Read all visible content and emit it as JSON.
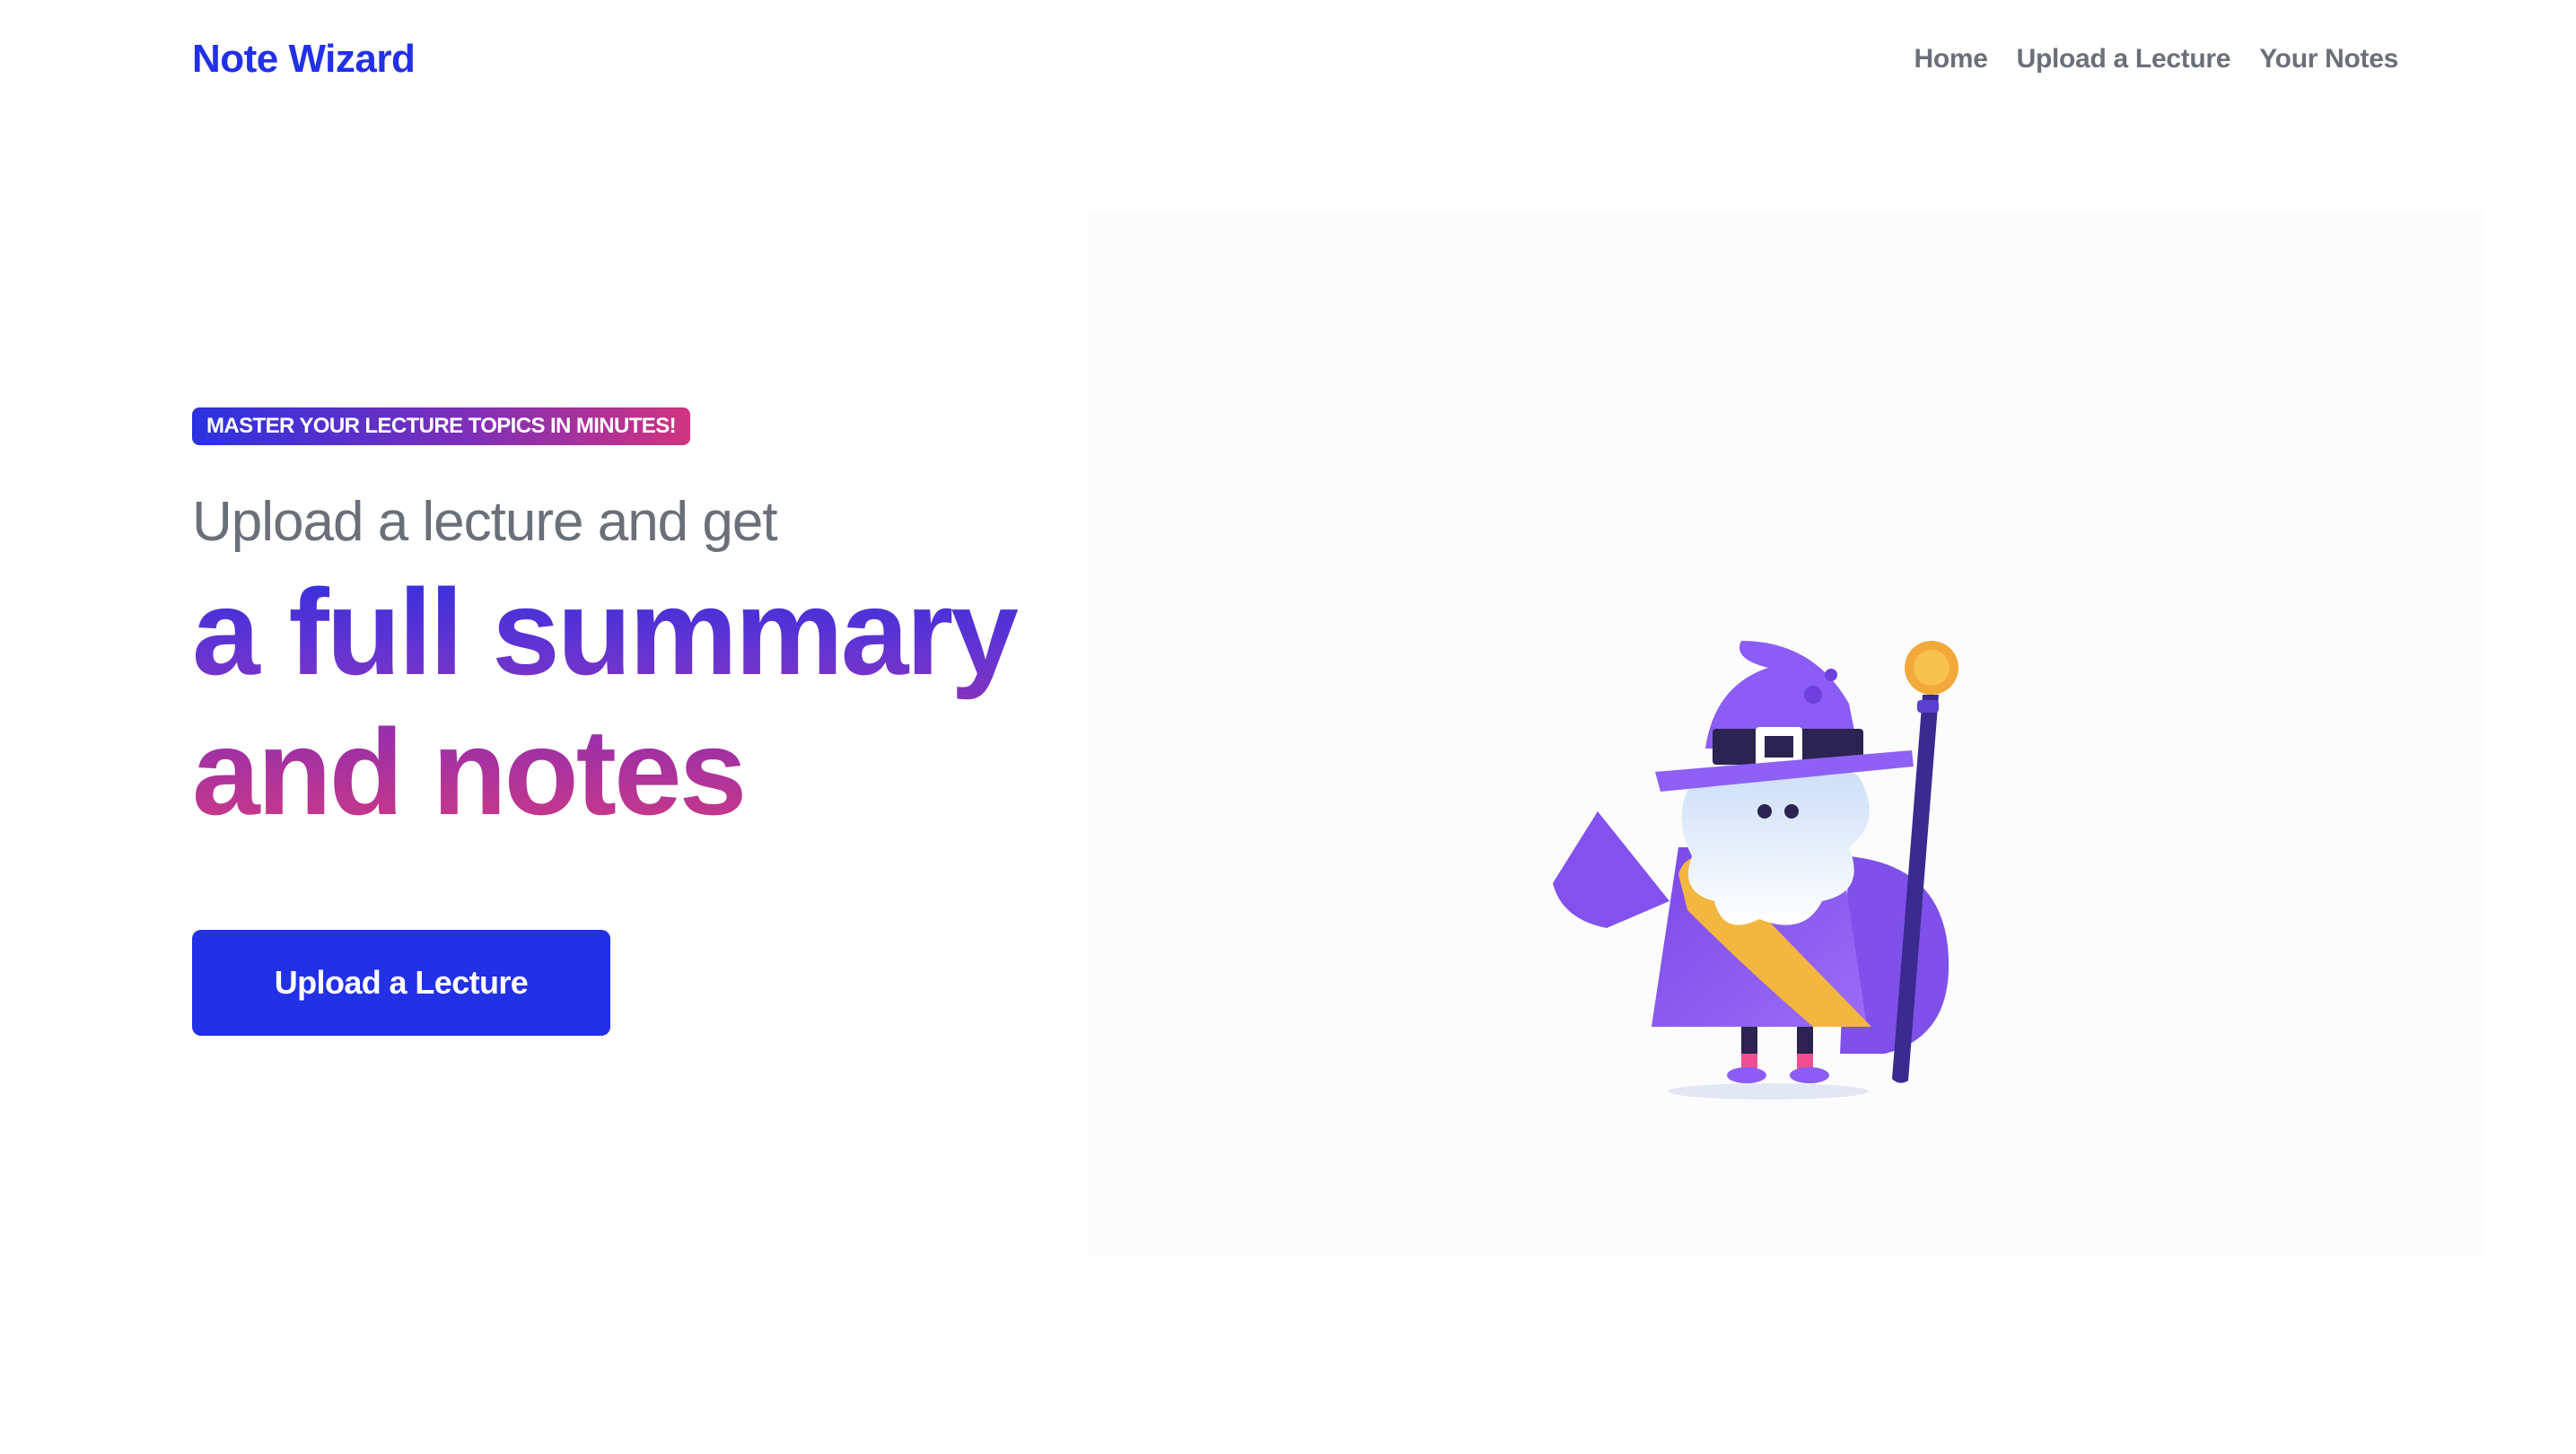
{
  "header": {
    "brand": "Note Wizard",
    "nav": [
      {
        "label": "Home"
      },
      {
        "label": "Upload a Lecture"
      },
      {
        "label": "Your Notes"
      }
    ]
  },
  "hero": {
    "badge": "MASTER YOUR LECTURE TOPICS IN MINUTES!",
    "subhead": "Upload a lecture and get",
    "headline_line1": "a full summary",
    "headline_line2": "and notes",
    "cta_label": "Upload a Lecture"
  },
  "illustration": {
    "icon": "wizard-illustration",
    "colors": {
      "primary_blue": "#2230e6",
      "wizard_purple": "#8b5cf6",
      "staff_gold": "#f5b73b",
      "badge_pink": "#d0347e"
    }
  }
}
